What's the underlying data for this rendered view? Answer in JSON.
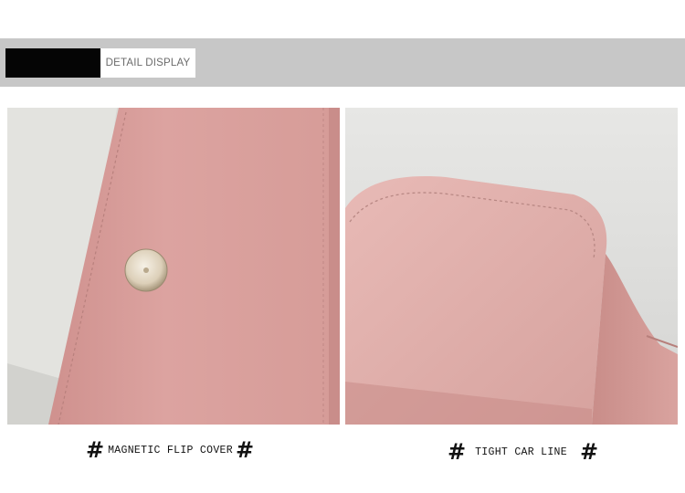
{
  "header": {
    "label": "DETAIL DISPLAY"
  },
  "captions": {
    "left": {
      "prefix": "#",
      "text": "MAGNETIC FLIP COVER",
      "suffix": "#"
    },
    "right": {
      "prefix": "#",
      "text": "TIGHT CAR LINE",
      "suffix": "#"
    }
  },
  "colors": {
    "band": "#c7c7c7",
    "pink_leather": "#d79b98",
    "pink_light": "#e6b1ad",
    "snap_metal": "#e6dccb"
  }
}
